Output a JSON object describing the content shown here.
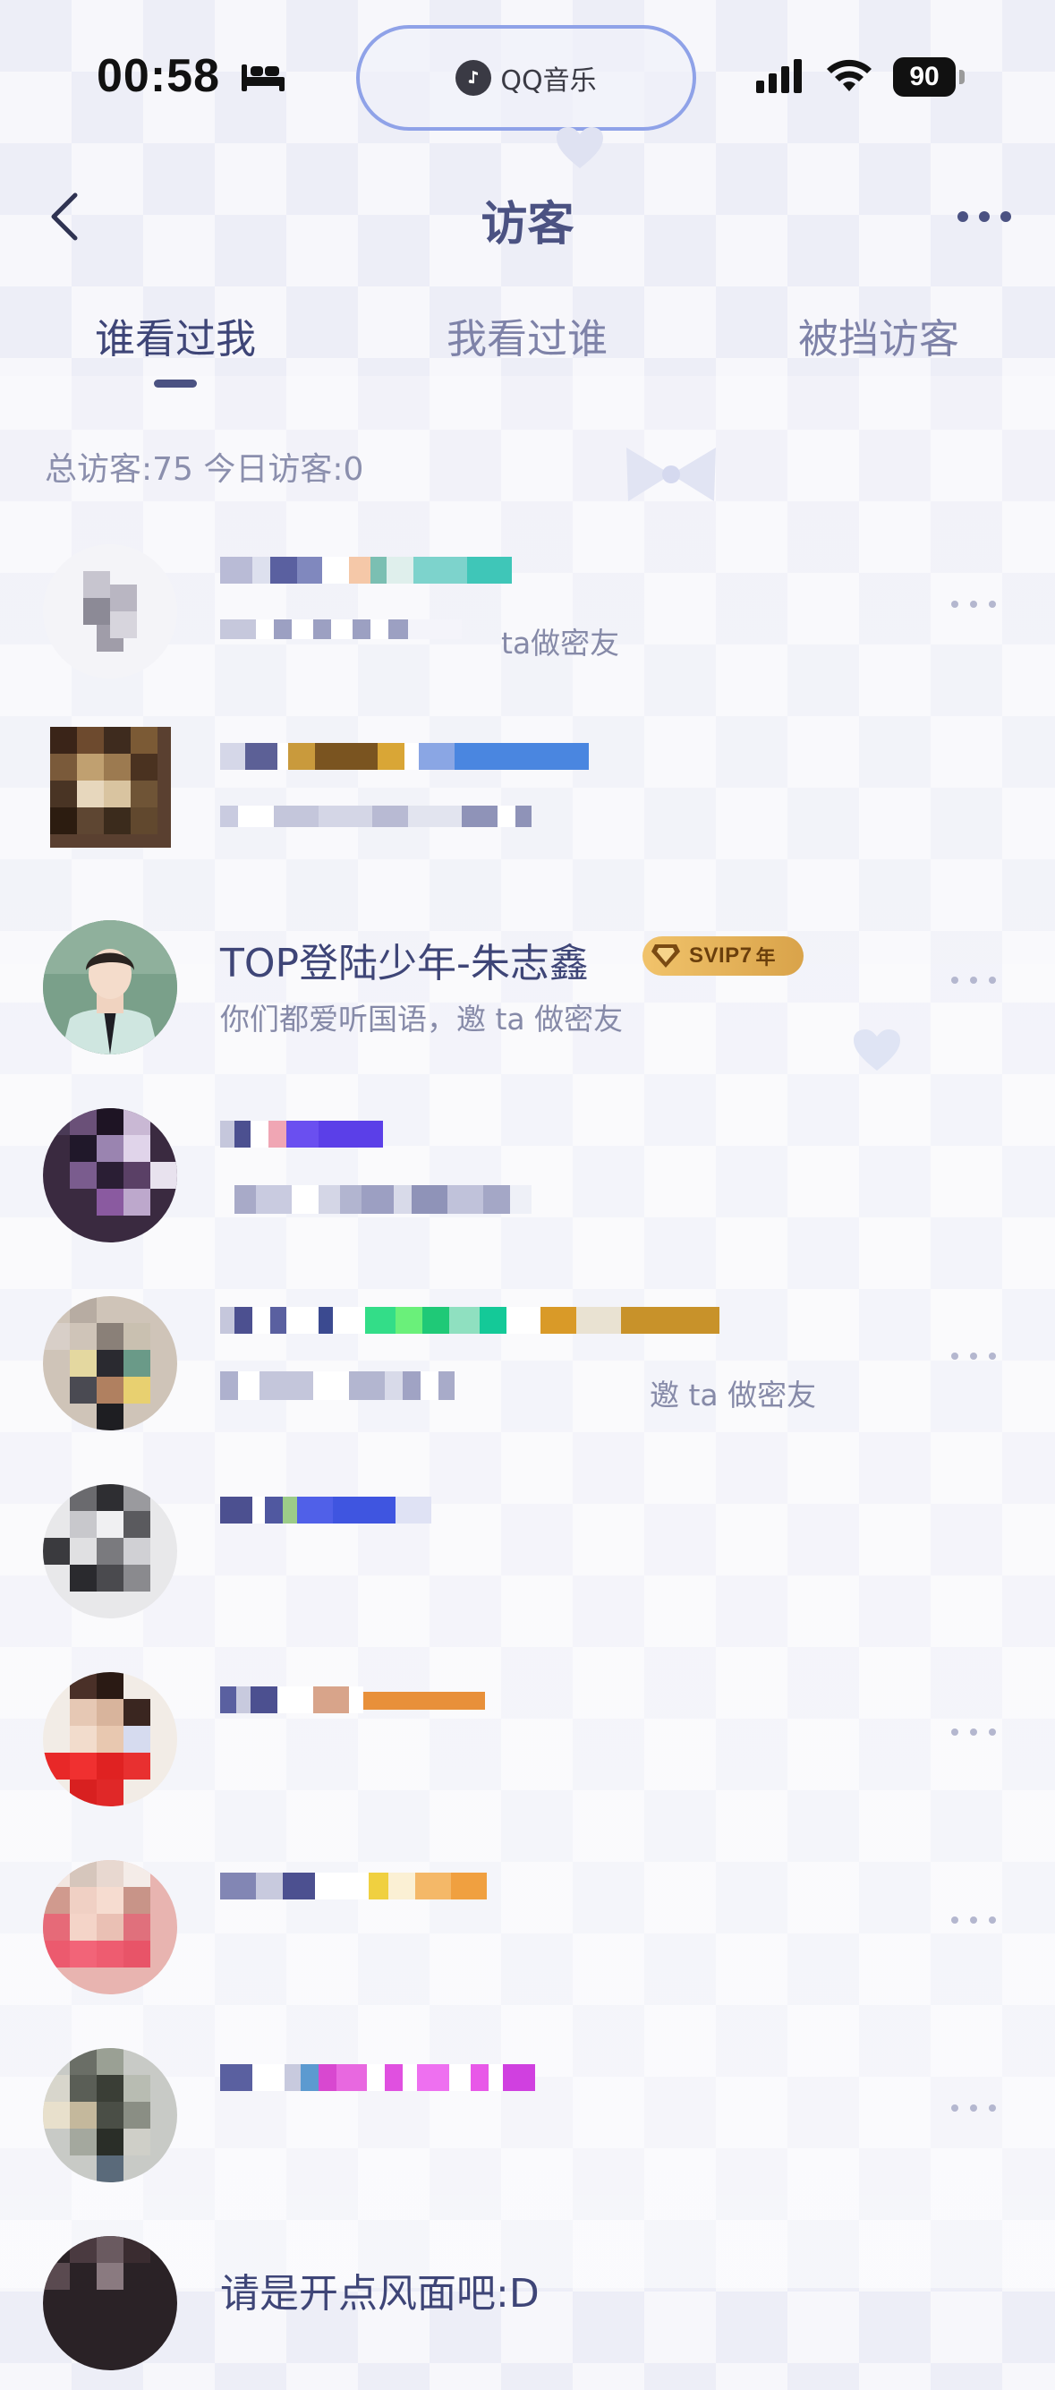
{
  "status_bar": {
    "time": "00:58",
    "island_label": "QQ音乐",
    "battery": "90"
  },
  "nav": {
    "title": "访客"
  },
  "tabs": [
    {
      "label": "谁看过我",
      "active": true
    },
    {
      "label": "我看过谁",
      "active": false
    },
    {
      "label": "被挡访客",
      "active": false
    }
  ],
  "stats": {
    "text": "总访客:75 今日访客:0"
  },
  "visitors": [
    {
      "name": "",
      "subtitle": "ta做密友"
    },
    {
      "name": "",
      "subtitle": ""
    },
    {
      "name": "TOP登陆少年-朱志鑫",
      "subtitle": "你们都爱听国语，邀 ta 做密友",
      "badge": "SVIP7",
      "badge_suffix": "年"
    },
    {
      "name": "",
      "subtitle": ""
    },
    {
      "name": "",
      "subtitle": "邀 ta 做密友"
    },
    {
      "name": "",
      "subtitle": ""
    },
    {
      "name": "",
      "subtitle": ""
    },
    {
      "name": "",
      "subtitle": ""
    },
    {
      "name": "",
      "subtitle": ""
    },
    {
      "name": "请是开点风面吧:D",
      "subtitle": ""
    }
  ],
  "colors": {
    "accent": "#4b5282",
    "text_primary": "#3e4577",
    "text_secondary": "#868aa8",
    "island_border": "#8fa2e8",
    "vip_gold": "#e3b35b"
  }
}
